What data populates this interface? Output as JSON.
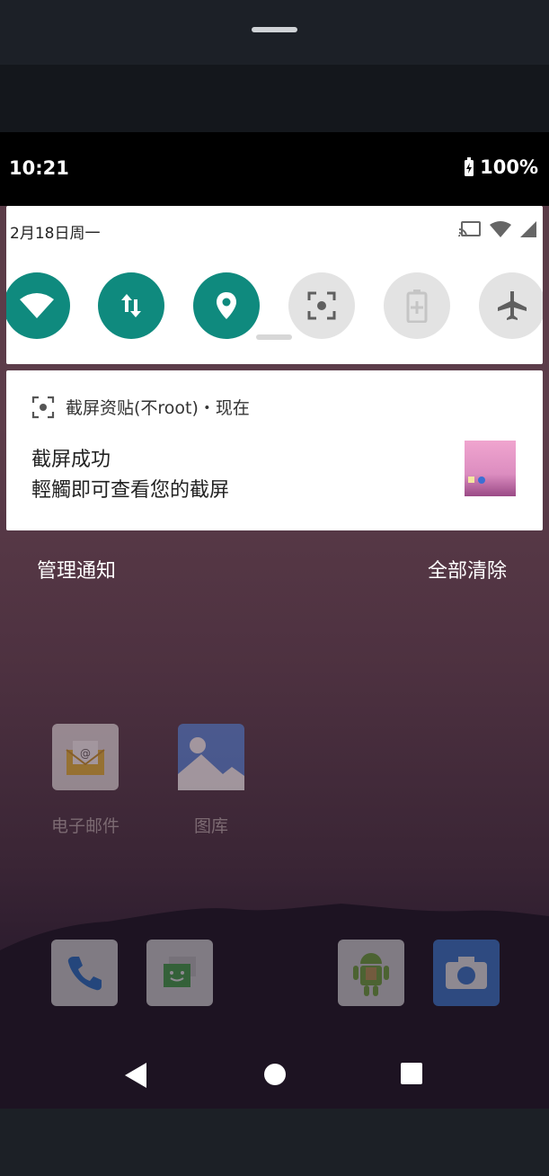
{
  "status_bar": {
    "time": "10:21",
    "battery": "100%"
  },
  "quick_settings": {
    "date": "2月18日周一",
    "tiles": [
      {
        "name": "wifi",
        "state": "on",
        "icon": "wifi-icon"
      },
      {
        "name": "mobile-data",
        "state": "on",
        "icon": "data-arrows-icon"
      },
      {
        "name": "location",
        "state": "on",
        "icon": "location-pin-icon"
      },
      {
        "name": "screenshot",
        "state": "off",
        "icon": "screenshot-icon"
      },
      {
        "name": "battery-saver",
        "state": "off",
        "icon": "battery-saver-icon"
      },
      {
        "name": "airplane",
        "state": "off",
        "icon": "airplane-icon"
      }
    ]
  },
  "notification": {
    "app_line": "截屏资贴(不root)・现在",
    "title": "截屏成功",
    "text": "輕觸即可查看您的截屏"
  },
  "notification_actions": {
    "manage": "管理通知",
    "clear_all": "全部清除"
  },
  "home_apps": [
    {
      "label": "电子邮件",
      "icon": "email-icon"
    },
    {
      "label": "图库",
      "icon": "gallery-icon"
    }
  ],
  "dock": [
    {
      "icon": "phone-icon"
    },
    {
      "icon": "messaging-icon"
    },
    {
      "icon": "android-app-icon"
    },
    {
      "icon": "camera-icon"
    }
  ],
  "colors": {
    "tile_on": "#0f8a7e",
    "tile_off": "#e3e3e3"
  }
}
